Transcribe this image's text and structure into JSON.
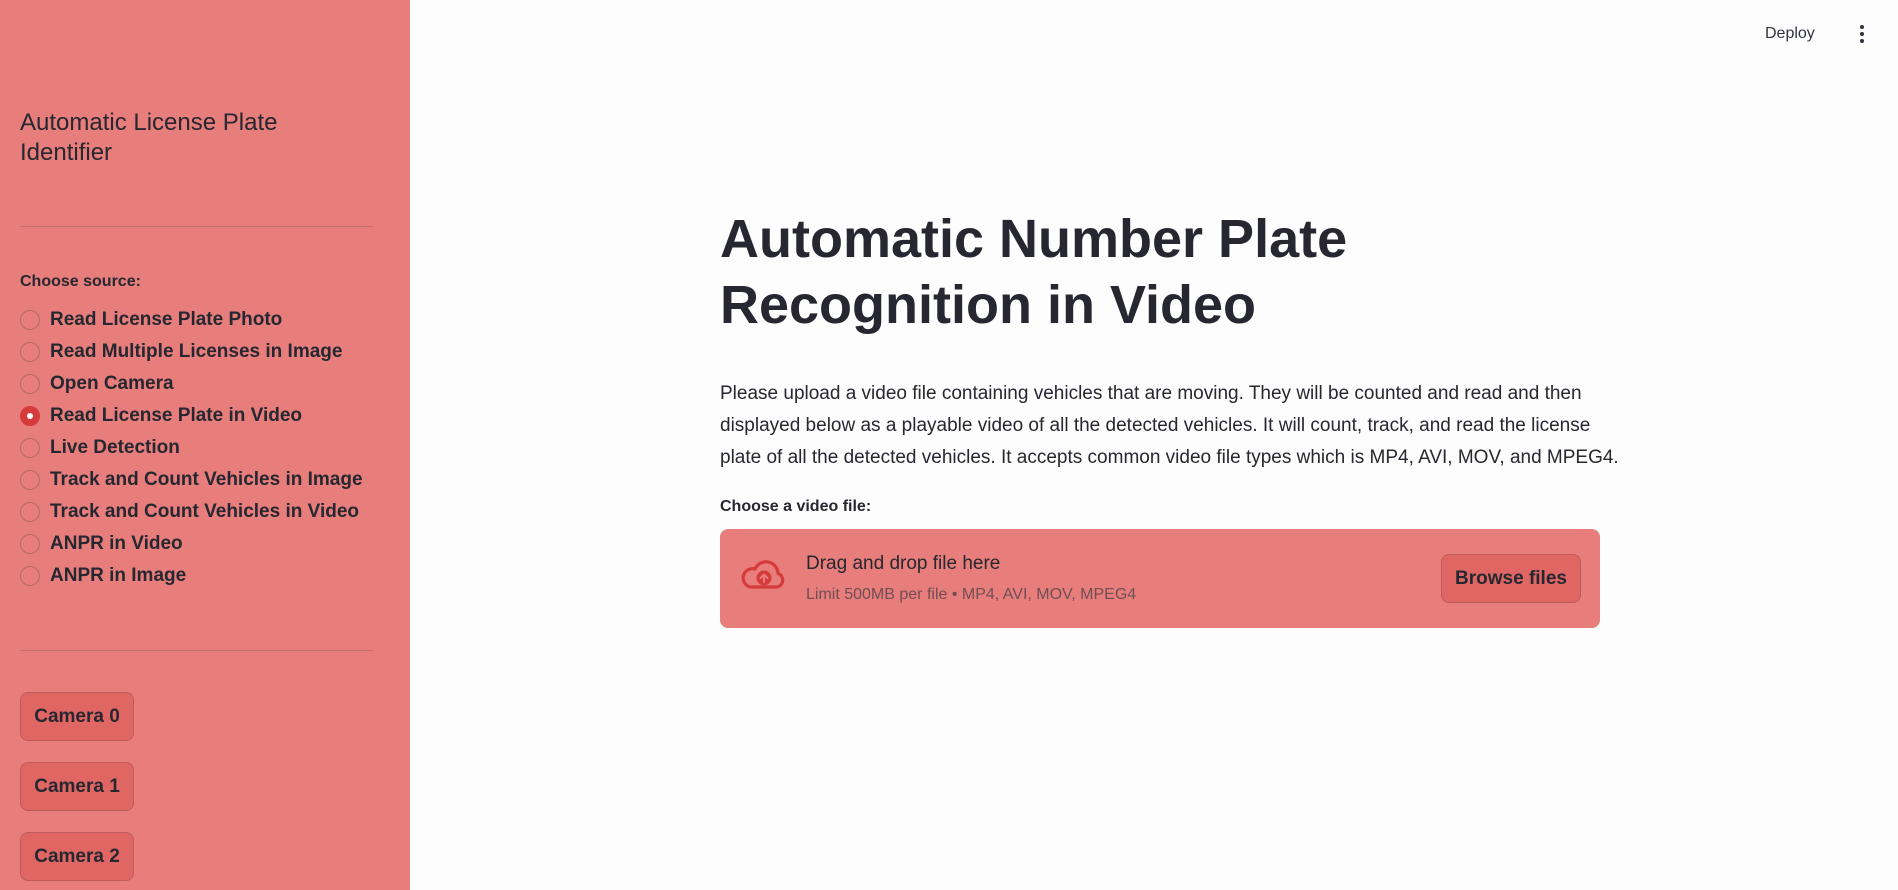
{
  "sidebar": {
    "title": "Automatic License Plate Identifier",
    "source_label": "Choose source:",
    "sources": [
      "Read License Plate Photo",
      "Read Multiple Licenses in Image",
      "Open Camera",
      "Read License Plate in Video",
      "Live Detection",
      "Track and Count Vehicles in Image",
      "Track and Count Vehicles in Video",
      "ANPR in Video",
      "ANPR in Image"
    ],
    "selected_source": "Read License Plate in Video",
    "camera_buttons": [
      "Camera 0",
      "Camera 1",
      "Camera 2"
    ]
  },
  "header": {
    "deploy_label": "Deploy",
    "menu_icon": "vertical-dots-icon"
  },
  "main": {
    "title": "Automatic Number Plate Recognition in Video",
    "description": "Please upload a video file containing vehicles that are moving. They will be counted and read and then displayed below as a playable video of all the detected vehicles. It will count, track, and read the license plate of all the detected vehicles. It accepts common video file types which is MP4, AVI, MOV, and MPEG4.",
    "uploader": {
      "label": "Choose a video file:",
      "drop_text": "Drag and drop file here",
      "limit_text": "Limit 500MB per file • MP4, AVI, MOV, MPEG4",
      "browse_label": "Browse files",
      "icon": "cloud-upload-icon"
    }
  },
  "colors": {
    "sidebar_bg": "#e87e7b",
    "button_bg": "#e06663",
    "accent": "#d63b3b",
    "main_bg": "#fdfdfd"
  }
}
